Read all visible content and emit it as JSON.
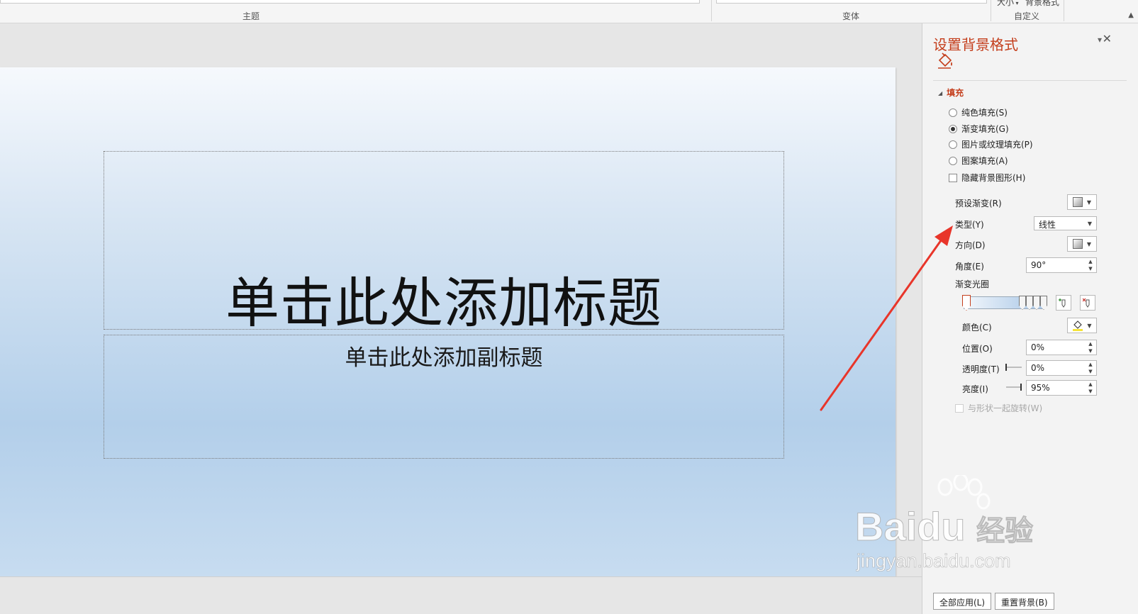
{
  "ribbon": {
    "theme_group_label": "主题",
    "variant_group_label": "变体",
    "customize_group_label": "自定义",
    "size_label": "大小",
    "format_background_label": "背景格式"
  },
  "slide": {
    "title_placeholder": "单击此处添加标题",
    "subtitle_placeholder": "单击此处添加副标题"
  },
  "pane": {
    "title": "设置背景格式",
    "section_fill": "填充",
    "options": {
      "solid_fill": "纯色填充(S)",
      "gradient_fill": "渐变填充(G)",
      "picture_fill": "图片或纹理填充(P)",
      "pattern_fill": "图案填充(A)",
      "hide_bg_graphics": "隐藏背景图形(H)"
    },
    "selected_fill": "gradient_fill",
    "preset_gradient_label": "预设渐变(R)",
    "type_label": "类型(Y)",
    "type_value": "线性",
    "direction_label": "方向(D)",
    "angle_label": "角度(E)",
    "angle_value": "90°",
    "gradient_stops_label": "渐变光圈",
    "color_label": "颜色(C)",
    "position_label": "位置(O)",
    "position_value": "0%",
    "transparency_label": "透明度(T)",
    "transparency_value": "0%",
    "brightness_label": "亮度(I)",
    "brightness_value": "95%",
    "rotate_with_shape_label": "与形状一起旋转(W)",
    "apply_all_button": "全部应用(L)",
    "reset_background_button": "重置背景(B)"
  },
  "colors": {
    "accent": "#c43e1c",
    "arrow": "#e8352a",
    "gradient_start": "#f2f7fc",
    "gradient_end": "#a8c6e6"
  },
  "watermark": {
    "brand": "Bai",
    "brand_end": "du",
    "suffix": "经验",
    "url": "jingyan.baidu.com"
  }
}
